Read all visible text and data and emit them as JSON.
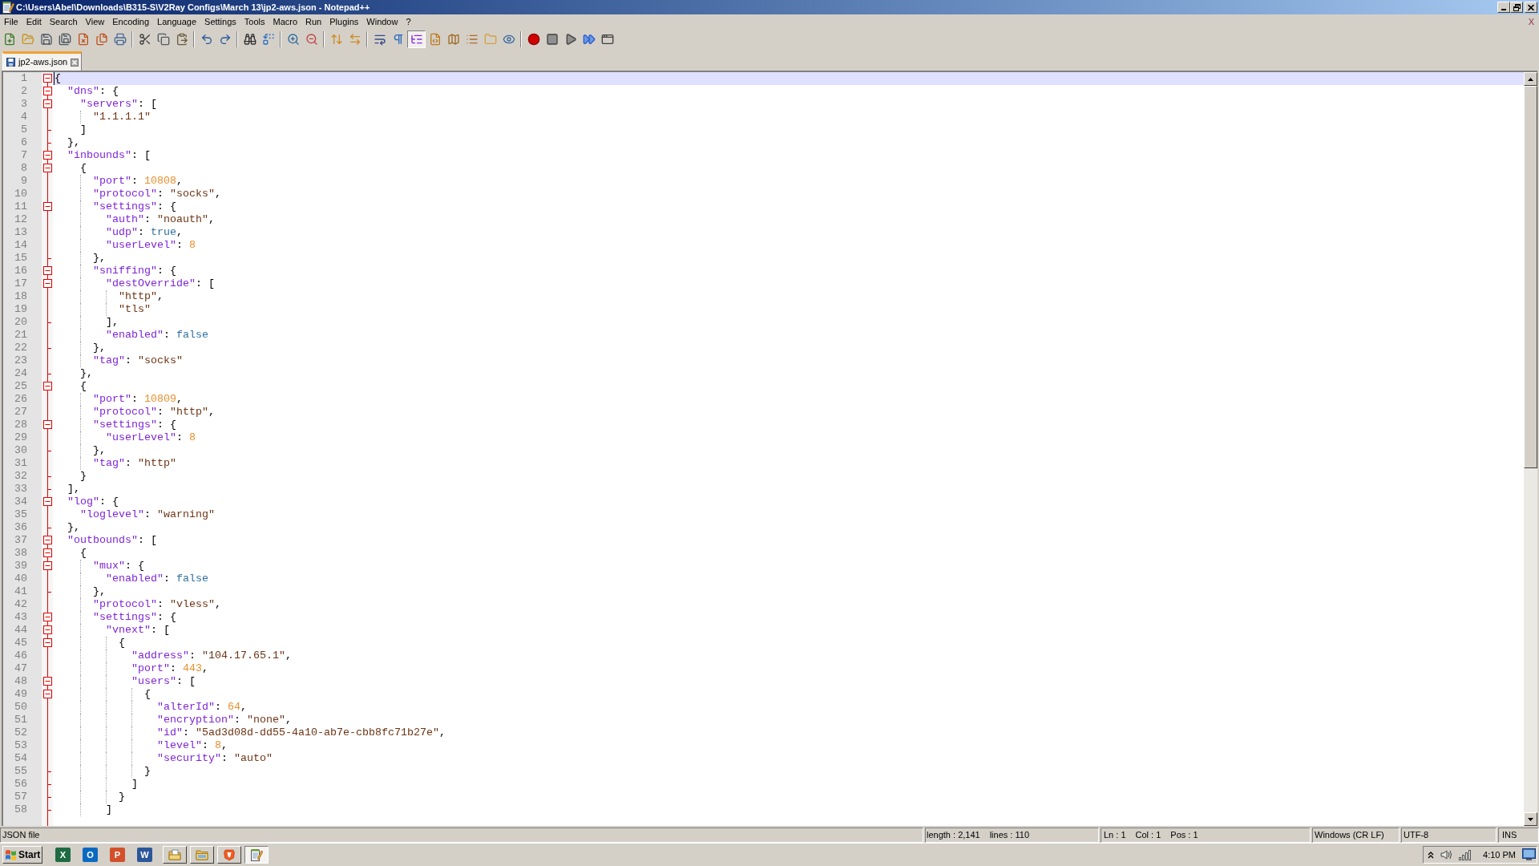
{
  "window": {
    "title": "C:\\Users\\Abel\\Downloads\\B315-S\\V2Ray Configs\\March 13\\jp2-aws.json - Notepad++"
  },
  "menu": {
    "items": [
      "File",
      "Edit",
      "Search",
      "View",
      "Encoding",
      "Language",
      "Settings",
      "Tools",
      "Macro",
      "Run",
      "Plugins",
      "Window",
      "?"
    ],
    "close_label": "X"
  },
  "toolbar": {
    "buttons": [
      {
        "pressed": false
      },
      {
        "pressed": false
      },
      {
        "pressed": false
      },
      {
        "pressed": false
      },
      {
        "pressed": false
      },
      {
        "pressed": false
      },
      {
        "pressed": false
      },
      {
        "pressed": false
      },
      {
        "pressed": false
      },
      {
        "pressed": false
      },
      {
        "pressed": false
      },
      {
        "pressed": false
      },
      {
        "pressed": false
      },
      {
        "pressed": false
      },
      {
        "pressed": false
      },
      {
        "pressed": false
      },
      {
        "pressed": false
      },
      {
        "pressed": false
      },
      {
        "pressed": false
      },
      {
        "pressed": false
      },
      {
        "pressed": true
      },
      {
        "pressed": false
      },
      {
        "pressed": false
      },
      {
        "pressed": false
      },
      {
        "pressed": false
      },
      {
        "pressed": false
      },
      {
        "pressed": false
      },
      {
        "pressed": false
      },
      {
        "pressed": false
      },
      {
        "pressed": false
      },
      {
        "pressed": false
      }
    ]
  },
  "tabs": [
    {
      "label": "jp2-aws.json",
      "selected": true
    }
  ],
  "editor": {
    "lines": [
      {
        "number": "1",
        "text": "{",
        "kind": "fold",
        "expanded": true,
        "current": true
      },
      {
        "number": "2",
        "text": "  \"dns\": {",
        "kind": "fold",
        "expanded": true,
        "current": false
      },
      {
        "number": "3",
        "text": "    \"servers\": [",
        "kind": "fold",
        "expanded": true,
        "current": false
      },
      {
        "number": "4",
        "text": "      \"1.1.1.1\"",
        "kind": "plain",
        "current": false
      },
      {
        "number": "5",
        "text": "    ]",
        "kind": "end",
        "current": false
      },
      {
        "number": "6",
        "text": "  },",
        "kind": "end",
        "current": false
      },
      {
        "number": "7",
        "text": "  \"inbounds\": [",
        "kind": "fold",
        "expanded": true,
        "current": false
      },
      {
        "number": "8",
        "text": "    {",
        "kind": "fold",
        "expanded": true,
        "current": false
      },
      {
        "number": "9",
        "text": "      \"port\": 10808,",
        "kind": "plain",
        "current": false
      },
      {
        "number": "10",
        "text": "      \"protocol\": \"socks\",",
        "kind": "plain",
        "current": false
      },
      {
        "number": "11",
        "text": "      \"settings\": {",
        "kind": "fold",
        "expanded": true,
        "current": false
      },
      {
        "number": "12",
        "text": "        \"auth\": \"noauth\",",
        "kind": "plain",
        "current": false
      },
      {
        "number": "13",
        "text": "        \"udp\": true,",
        "kind": "plain",
        "current": false
      },
      {
        "number": "14",
        "text": "        \"userLevel\": 8",
        "kind": "plain",
        "current": false
      },
      {
        "number": "15",
        "text": "      },",
        "kind": "end",
        "current": false
      },
      {
        "number": "16",
        "text": "      \"sniffing\": {",
        "kind": "fold",
        "expanded": true,
        "current": false
      },
      {
        "number": "17",
        "text": "        \"destOverride\": [",
        "kind": "fold",
        "expanded": true,
        "current": false
      },
      {
        "number": "18",
        "text": "          \"http\",",
        "kind": "plain",
        "current": false
      },
      {
        "number": "19",
        "text": "          \"tls\"",
        "kind": "plain",
        "current": false
      },
      {
        "number": "20",
        "text": "        ],",
        "kind": "end",
        "current": false
      },
      {
        "number": "21",
        "text": "        \"enabled\": false",
        "kind": "plain",
        "current": false
      },
      {
        "number": "22",
        "text": "      },",
        "kind": "end",
        "current": false
      },
      {
        "number": "23",
        "text": "      \"tag\": \"socks\"",
        "kind": "plain",
        "current": false
      },
      {
        "number": "24",
        "text": "    },",
        "kind": "end",
        "current": false
      },
      {
        "number": "25",
        "text": "    {",
        "kind": "fold",
        "expanded": true,
        "current": false
      },
      {
        "number": "26",
        "text": "      \"port\": 10809,",
        "kind": "plain",
        "current": false
      },
      {
        "number": "27",
        "text": "      \"protocol\": \"http\",",
        "kind": "plain",
        "current": false
      },
      {
        "number": "28",
        "text": "      \"settings\": {",
        "kind": "fold",
        "expanded": true,
        "current": false
      },
      {
        "number": "29",
        "text": "        \"userLevel\": 8",
        "kind": "plain",
        "current": false
      },
      {
        "number": "30",
        "text": "      },",
        "kind": "end",
        "current": false
      },
      {
        "number": "31",
        "text": "      \"tag\": \"http\"",
        "kind": "plain",
        "current": false
      },
      {
        "number": "32",
        "text": "    }",
        "kind": "end",
        "current": false
      },
      {
        "number": "33",
        "text": "  ],",
        "kind": "end",
        "current": false
      },
      {
        "number": "34",
        "text": "  \"log\": {",
        "kind": "fold",
        "expanded": true,
        "current": false
      },
      {
        "number": "35",
        "text": "    \"loglevel\": \"warning\"",
        "kind": "plain",
        "current": false
      },
      {
        "number": "36",
        "text": "  },",
        "kind": "end",
        "current": false
      },
      {
        "number": "37",
        "text": "  \"outbounds\": [",
        "kind": "fold",
        "expanded": true,
        "current": false
      },
      {
        "number": "38",
        "text": "    {",
        "kind": "fold",
        "expanded": true,
        "current": false
      },
      {
        "number": "39",
        "text": "      \"mux\": {",
        "kind": "fold",
        "expanded": true,
        "current": false
      },
      {
        "number": "40",
        "text": "        \"enabled\": false",
        "kind": "plain",
        "current": false
      },
      {
        "number": "41",
        "text": "      },",
        "kind": "end",
        "current": false
      },
      {
        "number": "42",
        "text": "      \"protocol\": \"vless\",",
        "kind": "plain",
        "current": false
      },
      {
        "number": "43",
        "text": "      \"settings\": {",
        "kind": "fold",
        "expanded": true,
        "current": false
      },
      {
        "number": "44",
        "text": "        \"vnext\": [",
        "kind": "fold",
        "expanded": true,
        "current": false
      },
      {
        "number": "45",
        "text": "          {",
        "kind": "fold",
        "expanded": true,
        "current": false
      },
      {
        "number": "46",
        "text": "            \"address\": \"104.17.65.1\",",
        "kind": "plain",
        "current": false
      },
      {
        "number": "47",
        "text": "            \"port\": 443,",
        "kind": "plain",
        "current": false
      },
      {
        "number": "48",
        "text": "            \"users\": [",
        "kind": "fold",
        "expanded": true,
        "current": false
      },
      {
        "number": "49",
        "text": "              {",
        "kind": "fold",
        "expanded": true,
        "current": false
      },
      {
        "number": "50",
        "text": "                \"alterId\": 64,",
        "kind": "plain",
        "current": false
      },
      {
        "number": "51",
        "text": "                \"encryption\": \"none\",",
        "kind": "plain",
        "current": false
      },
      {
        "number": "52",
        "text": "                \"id\": \"5ad3d08d-dd55-4a10-ab7e-cbb8fc71b27e\",",
        "kind": "plain",
        "current": false
      },
      {
        "number": "53",
        "text": "                \"level\": 8,",
        "kind": "plain",
        "current": false
      },
      {
        "number": "54",
        "text": "                \"security\": \"auto\"",
        "kind": "plain",
        "current": false
      },
      {
        "number": "55",
        "text": "              }",
        "kind": "end",
        "current": false
      },
      {
        "number": "56",
        "text": "            ]",
        "kind": "end",
        "current": false
      },
      {
        "number": "57",
        "text": "          }",
        "kind": "end",
        "current": false
      },
      {
        "number": "58",
        "text": "        ]",
        "kind": "end",
        "current": false
      }
    ]
  },
  "status_bar": {
    "file_type": "JSON file",
    "length": "length : 2,141",
    "lines": "lines : 110",
    "ln": "Ln : 1",
    "col": "Col : 1",
    "pos": "Pos : 1",
    "eol": "Windows (CR LF)",
    "encoding": "UTF-8",
    "mode": "INS"
  },
  "taskbar": {
    "start": "Start",
    "quick_launch": [
      {
        "label": "X",
        "color": "#1e6b41"
      },
      {
        "label": "O",
        "color": "#0a6ac2"
      },
      {
        "label": "P",
        "color": "#d2502a"
      },
      {
        "label": "W",
        "color": "#2b579a"
      }
    ],
    "windows": [
      {
        "active": false
      },
      {
        "active": false
      },
      {
        "active": false
      },
      {
        "active": true
      }
    ],
    "clock": "4:10 PM"
  }
}
